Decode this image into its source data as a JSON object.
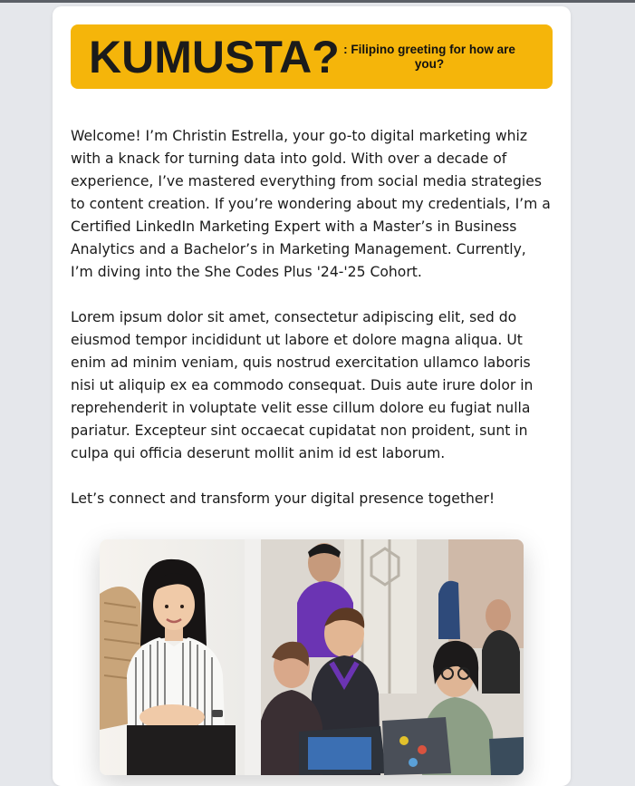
{
  "banner": {
    "title": "KUMUSTA?",
    "subtitle": ": Filipino greeting for how are you?"
  },
  "intro": {
    "paragraphs": [
      "Welcome! I’m Christin Estrella, your go-to digital marketing whiz with a knack for turning data into gold. With over a decade of experience, I’ve mastered everything from social media strategies to content creation. If you’re wondering about my credentials, I’m a Certified LinkedIn Marketing Expert with a Master’s in Business Analytics and a Bachelor’s in Marketing Management. Currently, I’m diving into the She Codes Plus '24-'25 Cohort.",
      "Lorem ipsum dolor sit amet, consectetur adipiscing elit, sed do eiusmod tempor incididunt ut labore et dolore magna aliqua. Ut enim ad minim veniam, quis nostrud exercitation ullamco laboris nisi ut aliquip ex ea commodo consequat. Duis aute irure dolor in reprehenderit in voluptate velit esse cillum dolore eu fugiat nulla pariatur. Excepteur sint occaecat cupidatat non proident, sunt in culpa qui officia deserunt mollit anim id est laborum.",
      "Let’s connect and transform your digital presence together!"
    ]
  },
  "photos": {
    "portrait_icon": "portrait-photo",
    "event_icon": "group-coding-photo"
  },
  "colors": {
    "banner": "#f5b50a",
    "page_background": "#e5e7eb",
    "card": "#ffffff",
    "text": "#1a1a1a"
  }
}
